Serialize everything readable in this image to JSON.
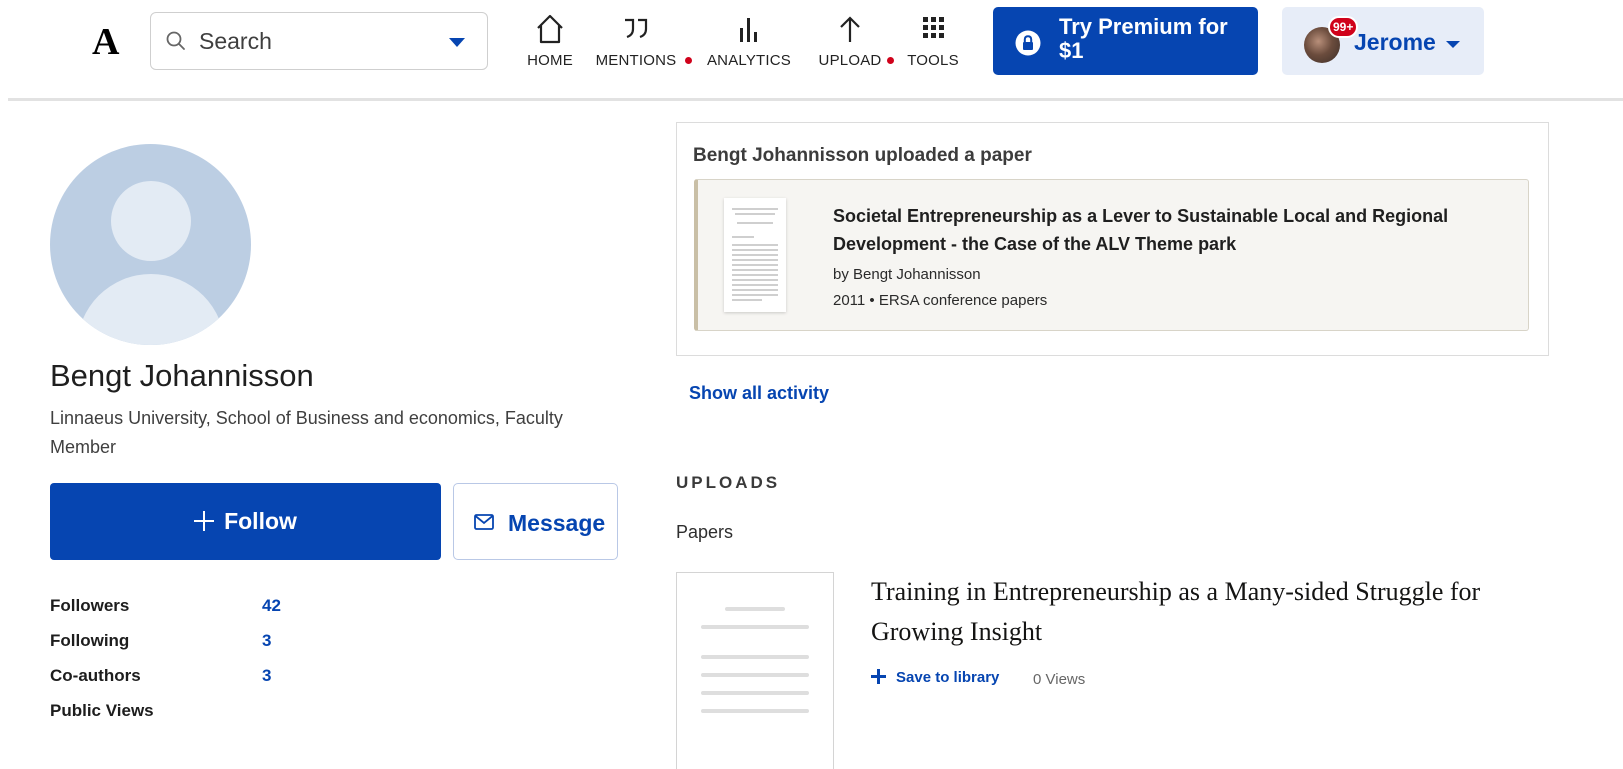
{
  "header": {
    "logo": "A",
    "search": {
      "placeholder": "Search"
    },
    "nav": [
      {
        "label": "HOME",
        "icon": "home-icon"
      },
      {
        "label": "MENTIONS",
        "icon": "quote-icon",
        "notification_dot": true
      },
      {
        "label": "ANALYTICS",
        "icon": "bar-chart-icon"
      },
      {
        "label": "UPLOAD",
        "icon": "upload-arrow-icon",
        "notification_dot": true
      },
      {
        "label": "TOOLS",
        "icon": "grid-icon"
      }
    ],
    "premium_button": "Try Premium for $1",
    "user": {
      "name": "Jerome",
      "badge": "99+"
    }
  },
  "profile": {
    "name": "Bengt Johannisson",
    "affiliation": "Linnaeus University, School of Business and economics, Faculty Member",
    "follow_label": "Follow",
    "message_label": "Message",
    "stats": [
      {
        "label": "Followers",
        "value": "42"
      },
      {
        "label": "Following",
        "value": "3"
      },
      {
        "label": "Co-authors",
        "value": "3"
      },
      {
        "label": "Public Views",
        "value": ""
      }
    ]
  },
  "activity": {
    "heading": "Bengt Johannisson uploaded a paper",
    "paper": {
      "title": "Societal Entrepreneurship as a Lever to Sustainable Local and Regional Development - the Case of the ALV Theme park",
      "by": "by Bengt Johannisson",
      "meta": "2011 • ERSA conference papers"
    },
    "show_all": "Show all activity"
  },
  "uploads": {
    "heading": "UPLOADS",
    "section": "Papers",
    "items": [
      {
        "title": "Training in Entrepreneurship as a Many-sided Struggle for Growing Insight",
        "save_label": "Save to library",
        "views": "0 Views"
      }
    ]
  },
  "colors": {
    "brand_blue": "#0645b1",
    "notification_red": "#d0021b",
    "avatar_placeholder": "#bccee3",
    "user_button_bg": "#e7edf8"
  }
}
